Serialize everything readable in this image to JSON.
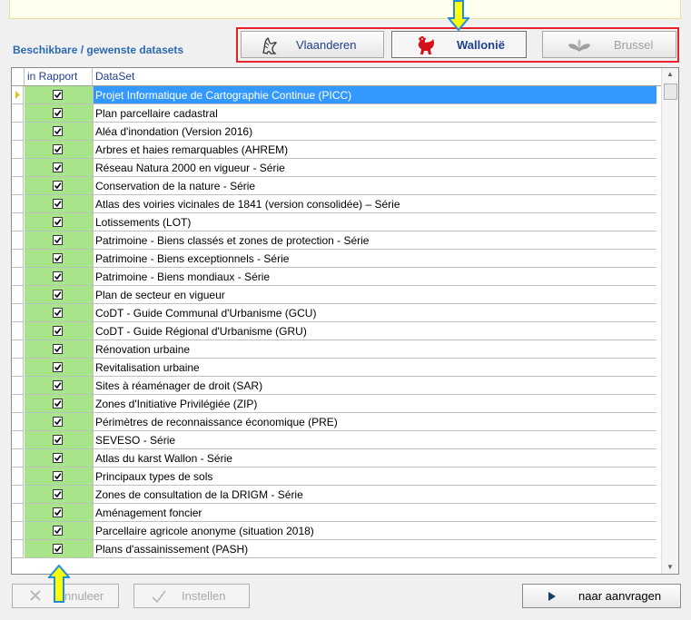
{
  "section_label": "Beschikbare / gewenste datasets",
  "regions": {
    "vlaanderen": "Vlaanderen",
    "wallonie": "Wallonië",
    "brussel": "Brussel"
  },
  "grid": {
    "col_in_rapport": "in Rapport",
    "col_dataset": "DataSet",
    "rows": [
      {
        "name": "Projet Informatique de Cartographie Continue (PICC)",
        "checked": true,
        "selected": true
      },
      {
        "name": "Plan parcellaire cadastral",
        "checked": true
      },
      {
        "name": "Aléa d'inondation (Version 2016)",
        "checked": true
      },
      {
        "name": "Arbres et haies remarquables (AHREM)",
        "checked": true
      },
      {
        "name": "Réseau Natura 2000 en vigueur - Série",
        "checked": true
      },
      {
        "name": "Conservation de la nature - Série",
        "checked": true
      },
      {
        "name": "Atlas des voiries vicinales de 1841 (version consolidée) – Série",
        "checked": true
      },
      {
        "name": "Lotissements (LOT)",
        "checked": true
      },
      {
        "name": "Patrimoine - Biens classés et zones de protection - Série",
        "checked": true
      },
      {
        "name": "Patrimoine - Biens exceptionnels - Série",
        "checked": true
      },
      {
        "name": "Patrimoine - Biens mondiaux - Série",
        "checked": true
      },
      {
        "name": "Plan de secteur en vigueur",
        "checked": true
      },
      {
        "name": "CoDT - Guide Communal d'Urbanisme (GCU)",
        "checked": true
      },
      {
        "name": "CoDT - Guide Régional d'Urbanisme (GRU)",
        "checked": true
      },
      {
        "name": "Rénovation urbaine",
        "checked": true
      },
      {
        "name": "Revitalisation urbaine",
        "checked": true
      },
      {
        "name": "Sites à réaménager de droit (SAR)",
        "checked": true
      },
      {
        "name": "Zones d'Initiative Privilégiée (ZIP)",
        "checked": true
      },
      {
        "name": "Périmètres de reconnaissance économique (PRE)",
        "checked": true
      },
      {
        "name": "SEVESO - Série",
        "checked": true
      },
      {
        "name": "Atlas du karst Wallon - Série",
        "checked": true
      },
      {
        "name": "Principaux types de sols",
        "checked": true
      },
      {
        "name": "Zones de consultation de la DRIGM - Série",
        "checked": true
      },
      {
        "name": "Aménagement foncier",
        "checked": true
      },
      {
        "name": "Parcellaire agricole anonyme (situation 2018)",
        "checked": true
      },
      {
        "name": "Plans d'assainissement (PASH)",
        "checked": true
      }
    ]
  },
  "buttons": {
    "annuleer": "nnuleer",
    "instellen": "Instellen",
    "naar_aanvragen": "naar aanvragen"
  },
  "colors": {
    "accent": "#2a6ab0",
    "selection": "#3399ff",
    "check_bg": "#a8e48a",
    "highlight_box": "#e8202a",
    "callout_arrow": "#ffff00"
  }
}
